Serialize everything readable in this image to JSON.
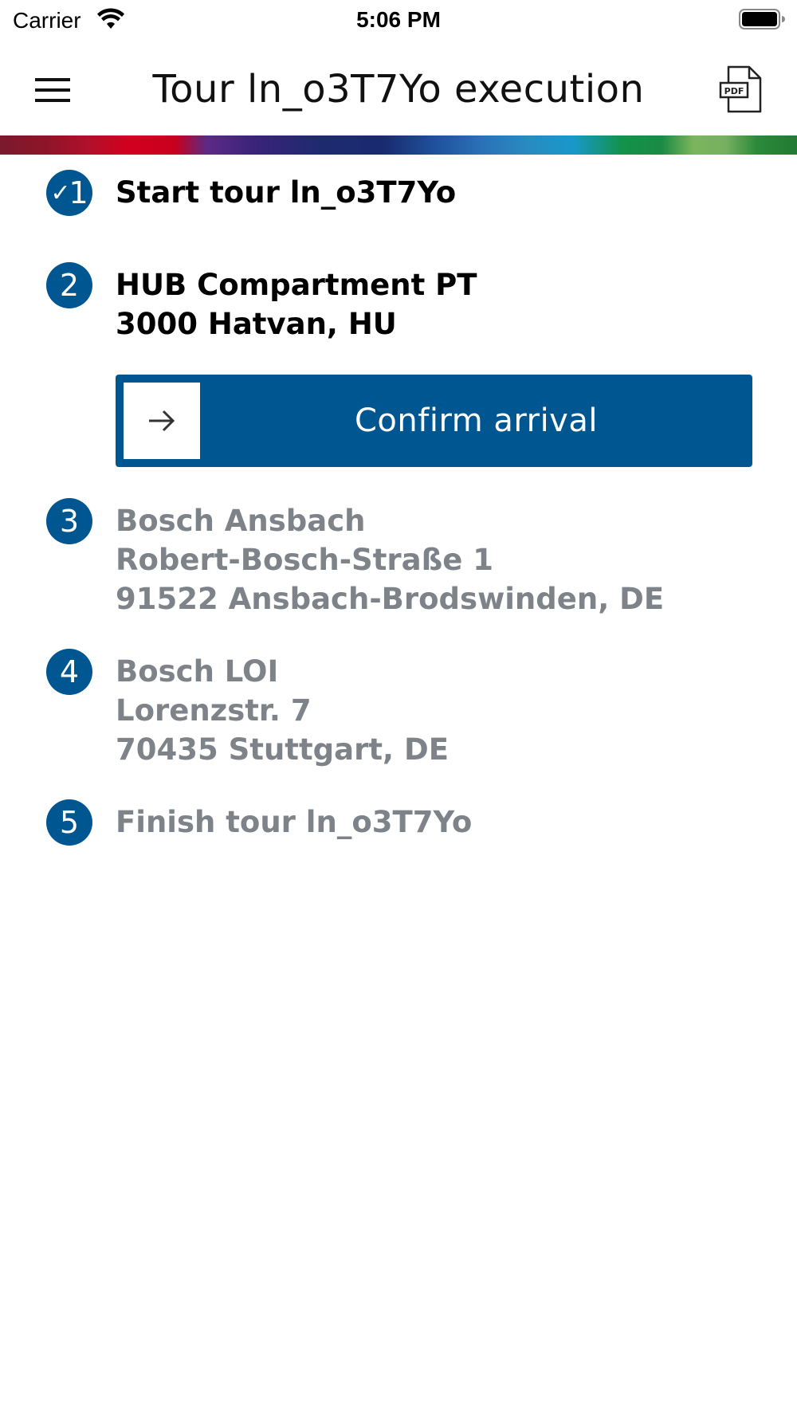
{
  "status_bar": {
    "carrier": "Carrier",
    "time": "5:06 PM"
  },
  "header": {
    "title": "Tour ln_o3T7Yo execution",
    "menu_icon": "hamburger-menu-icon",
    "pdf_icon": "pdf-document-icon",
    "pdf_icon_text": "PDF"
  },
  "colors": {
    "primary": "#005691",
    "muted_text": "#7d8389"
  },
  "steps": [
    {
      "number": "1",
      "completed": true,
      "lines": [
        "Start tour ln_o3T7Yo"
      ]
    },
    {
      "number": "2",
      "completed": false,
      "active": true,
      "lines": [
        "HUB Compartment PT",
        "3000 Hatvan, HU"
      ]
    },
    {
      "number": "3",
      "completed": false,
      "lines": [
        "Bosch Ansbach",
        "Robert-Bosch-Straße 1",
        "91522 Ansbach-Brodswinden, DE"
      ]
    },
    {
      "number": "4",
      "completed": false,
      "lines": [
        "Bosch LOI",
        "Lorenzstr. 7",
        "70435 Stuttgart, DE"
      ]
    },
    {
      "number": "5",
      "completed": false,
      "lines": [
        "Finish tour ln_o3T7Yo"
      ]
    }
  ],
  "confirm_button": {
    "label": "Confirm arrival",
    "icon": "arrow-right-icon"
  }
}
